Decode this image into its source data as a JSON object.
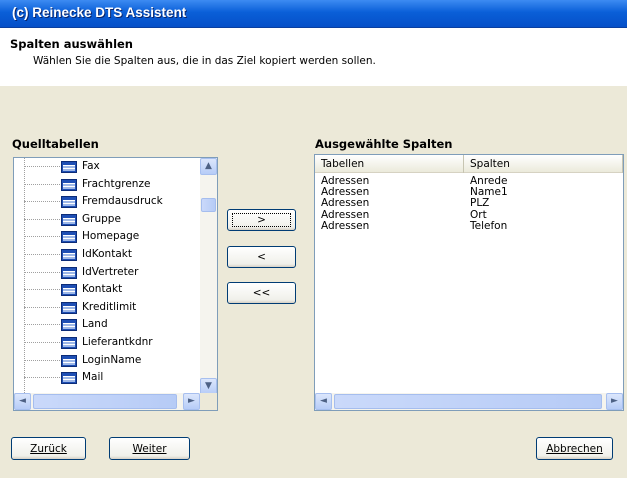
{
  "window": {
    "title": "(c) Reinecke DTS Assistent"
  },
  "header": {
    "title": "Spalten auswählen",
    "subtitle": "Wählen Sie die Spalten aus, die in das Ziel kopiert werden sollen."
  },
  "source": {
    "label": "Quelltabellen",
    "items": [
      "Fax",
      "Frachtgrenze",
      "Fremdausdruck",
      "Gruppe",
      "Homepage",
      "IdKontakt",
      "IdVertreter",
      "Kontakt",
      "Kreditlimit",
      "Land",
      "Lieferantkdnr",
      "LoginName",
      "Mail"
    ]
  },
  "transfer": {
    "add": ">",
    "remove": "<",
    "remove_all": "<<"
  },
  "selected": {
    "label": "Ausgewählte Spalten",
    "columns": [
      "Tabellen",
      "Spalten"
    ],
    "rows": [
      [
        "Adressen",
        "Anrede"
      ],
      [
        "Adressen",
        "Name1"
      ],
      [
        "Adressen",
        "PLZ"
      ],
      [
        "Adressen",
        "Ort"
      ],
      [
        "Adressen",
        "Telefon"
      ]
    ]
  },
  "footer": {
    "back": "Zurück",
    "next": "Weiter",
    "cancel": "Abbrechen"
  },
  "icons": {
    "scroll_up": "▲",
    "scroll_down": "▼",
    "scroll_left": "◄",
    "scroll_right": "►",
    "table": "table-icon"
  }
}
